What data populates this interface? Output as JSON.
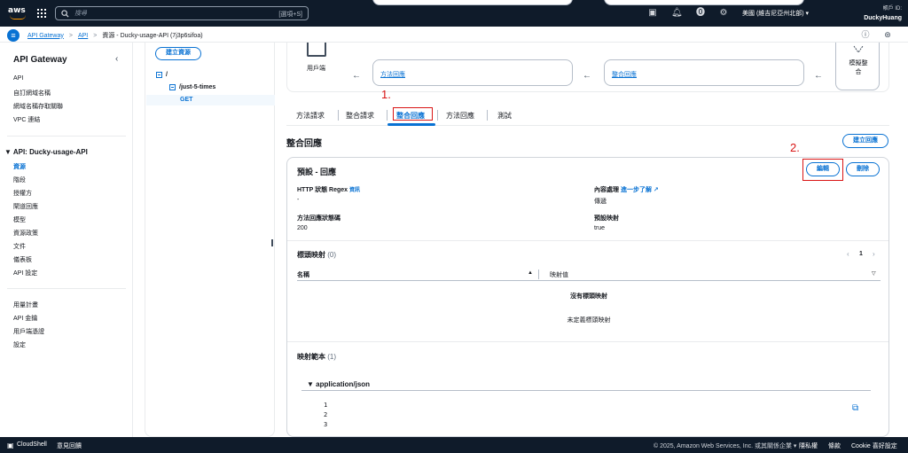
{
  "topbar": {
    "logo": "aws",
    "search_placeholder": "搜尋",
    "search_shortcut": "[選項+S]",
    "region": "美國 (維吉尼亞州北部) ▾",
    "account_id_label": "帳戶 ID:",
    "username": "DuckyHuang"
  },
  "breadcrumb": {
    "items": [
      "API Gateway",
      "API",
      "資源 - Ducky-usage-API (7j3p6sifoa)"
    ],
    "separator": ">"
  },
  "sidebar": {
    "title": "API Gateway",
    "top_items": [
      "API",
      "自訂網域名稱",
      "網域名稱存取關聯",
      "VPC 連結"
    ],
    "api_section": "▼ API: Ducky-usage-API",
    "api_items": [
      "資源",
      "階段",
      "授權方",
      "閘道回應",
      "模型",
      "資源政策",
      "文件",
      "儀表板",
      "API 設定"
    ],
    "bottom_items": [
      "用量計畫",
      "API 金鑰",
      "用戶端憑證",
      "設定"
    ]
  },
  "tree": {
    "create_button": "建立資源",
    "root": "/",
    "child": "/just-5-times",
    "method": "GET"
  },
  "flow": {
    "client_label": "用戶端",
    "method_response": "方法回應",
    "integration_response": "整合回應",
    "mock_label_1": "模擬整",
    "mock_label_2": "合",
    "arrow": "←"
  },
  "tabs": [
    "方法請求",
    "整合請求",
    "整合回應",
    "方法回應",
    "測試"
  ],
  "annotations": {
    "one": "1.",
    "two": "2."
  },
  "main": {
    "heading": "整合回應",
    "create_response_button": "建立回應",
    "card_title": "預設 - 回應",
    "edit_button": "編輯",
    "delete_button": "刪除",
    "http_regex_label": "HTTP 狀態 Regex",
    "info_link": "資訊",
    "http_regex_value": "-",
    "content_handling_label": "內容處理",
    "learn_more": "進一步了解",
    "content_handling_value": "傳遞",
    "method_status_label": "方法回應狀態碼",
    "method_status_value": "200",
    "default_mapping_label": "預設映射",
    "default_mapping_value": "true",
    "header_mappings_title": "標頭映射",
    "header_mappings_count": "(0)",
    "page_number": "1",
    "col_name": "名稱",
    "col_value": "映射值",
    "no_mappings": "沒有標頭映射",
    "no_mappings_desc": "未定義標頭映射",
    "templates_title": "映射範本",
    "templates_count": "(1)",
    "template_type": "▼ application/json",
    "code_lines": [
      "1",
      "2",
      "3"
    ]
  },
  "footer": {
    "cloudshell": "CloudShell",
    "feedback": "意見回饋",
    "copyright": "© 2025, Amazon Web Services, Inc. 或其關係企業 ▾",
    "privacy": "隱私權",
    "terms": "條款",
    "cookie": "Cookie 喜好設定"
  }
}
